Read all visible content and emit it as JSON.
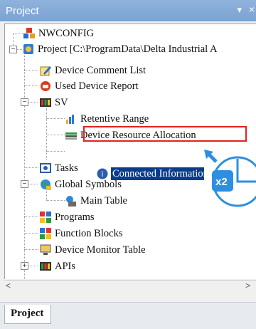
{
  "panel": {
    "title": "Project",
    "pin_glyph": "▾",
    "close_glyph": "×"
  },
  "tree": {
    "nwconfig": "NWCONFIG",
    "project": "Project [C:\\ProgramData\\Delta Industrial A",
    "device_comment_list": "Device Comment List",
    "used_device_report": "Used Device Report",
    "sv": "SV",
    "retentive_range": "Retentive Range",
    "device_resource_allocation": "Device Resource Allocation",
    "connected_information": "Connected Information",
    "tasks": "Tasks",
    "global_symbols": "Global Symbols",
    "main_table": "Main Table",
    "programs": "Programs",
    "function_blocks": "Function Blocks",
    "device_monitor_table": "Device Monitor Table",
    "apis": "APIs"
  },
  "annotation": {
    "double_click_label": "x2",
    "highlight_color": "#e1231e",
    "accent_color": "#2e8fe0"
  },
  "scrollbar": {
    "left_arrow": "<",
    "right_arrow": ">"
  },
  "tabs": {
    "project_tab": "Project"
  }
}
